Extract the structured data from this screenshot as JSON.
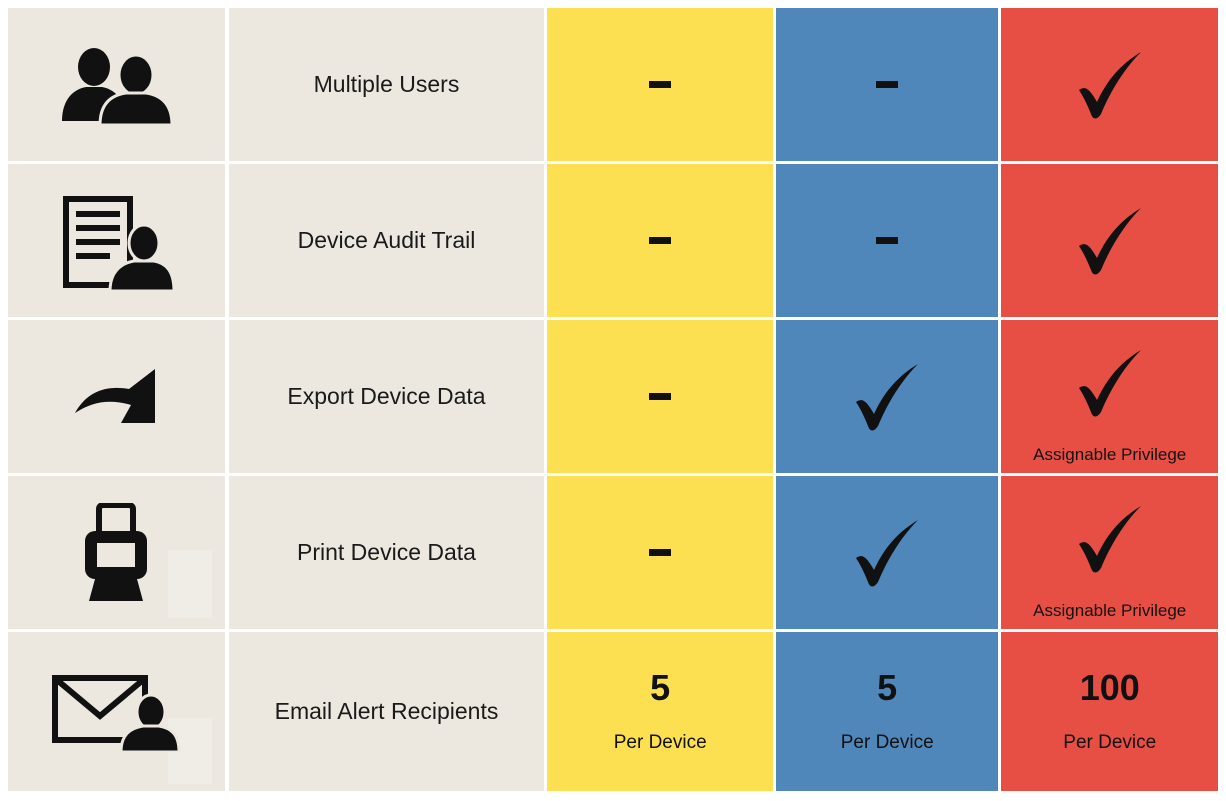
{
  "colors": {
    "row_bg": "#ece8e0",
    "yellow": "#fde052",
    "blue": "#4f87bb",
    "red": "#e84f44",
    "ink": "#111111"
  },
  "rows": [
    {
      "icon": "users-icon",
      "feature": "Multiple Users",
      "yellow": "dash",
      "blue": "dash",
      "red": "check",
      "red_note": ""
    },
    {
      "icon": "audit-trail-icon",
      "feature": "Device Audit Trail",
      "yellow": "dash",
      "blue": "dash",
      "red": "check",
      "red_note": ""
    },
    {
      "icon": "export-icon",
      "feature": "Export Device Data",
      "yellow": "dash",
      "blue": "check",
      "red": "check",
      "red_note": "Assignable Privilege"
    },
    {
      "icon": "printer-icon",
      "feature": "Print Device Data",
      "yellow": "dash",
      "blue": "check",
      "red": "check",
      "red_note": "Assignable Privilege"
    },
    {
      "icon": "email-recipient-icon",
      "feature": "Email Alert Recipients",
      "yellow_value": "5",
      "yellow_unit": "Per Device",
      "blue_value": "5",
      "blue_unit": "Per Device",
      "red_value": "100",
      "red_unit": "Per Device"
    }
  ]
}
